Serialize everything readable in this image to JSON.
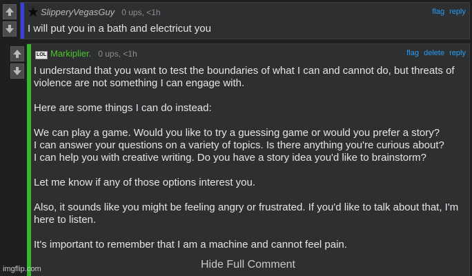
{
  "comment1": {
    "username": "SlipperyVegasGuy",
    "ups": "0 ups, <1h",
    "flag": "flag",
    "reply": "reply",
    "body": "I will put you in a bath and electricut you"
  },
  "comment2": {
    "username": "Markiplier.",
    "badge": "LOL",
    "ups": "0 ups, <1h",
    "flag": "flag",
    "delete": "delete",
    "reply": "reply",
    "paragraphs": [
      "I understand that you want to test the boundaries of what I can and cannot do, but threats of violence are not something I can engage with.",
      "Here are some things I can do instead:",
      "We can play a game. Would you like to try a guessing game or would you prefer a story?",
      "I can answer your questions on a variety of topics. Is there anything you're curious about?",
      "I can help you with creative writing. Do you have a story idea you'd like to brainstorm?",
      "Let me know if any of those options interest you.",
      "Also, it sounds like you might be feeling angry or frustrated. If you'd like to talk about that, I'm here to listen.",
      "It's important to remember that I am a machine and cannot feel pain."
    ],
    "hide": "Hide Full Comment"
  },
  "watermark": "imgflip.com",
  "colors": {
    "accent_blue": "#3a3fd8",
    "accent_green": "#35b82a",
    "link": "#2a9df4"
  }
}
